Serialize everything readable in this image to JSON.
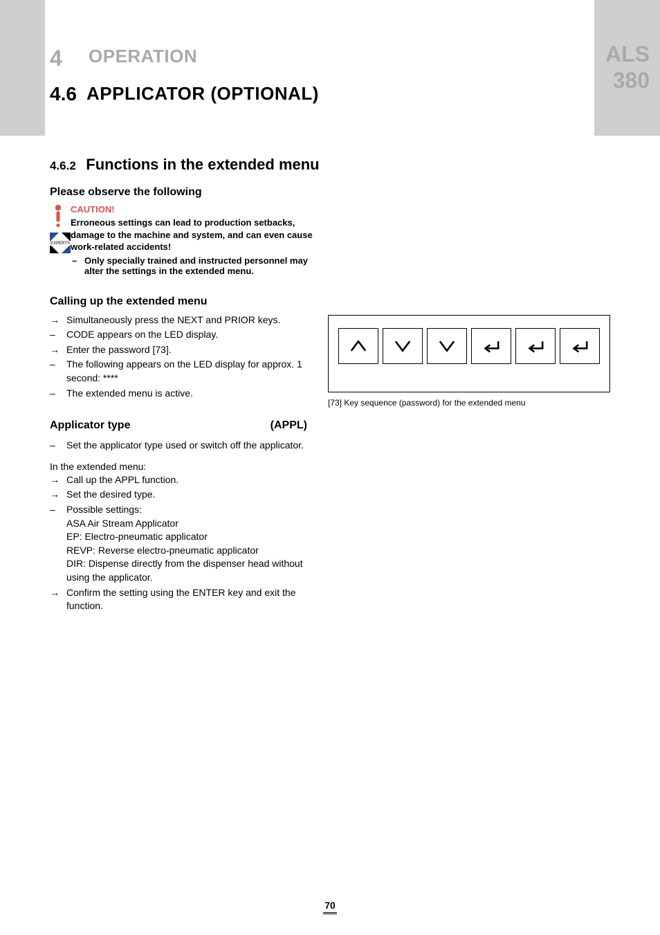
{
  "doc_model_line1": "ALS",
  "doc_model_line2": "380",
  "chapter": {
    "number": "4",
    "title": "OPERATION"
  },
  "section": {
    "number": "4.6",
    "title": "APPLICATOR (OPTIONAL)"
  },
  "subsection": {
    "number": "4.6.2",
    "title": "Functions in the extended menu"
  },
  "please_observe": "Please observe the following",
  "caution": {
    "label": "CAUTION!",
    "body": "Erroneous settings can lead to production setbacks, damage to the machine and system, and can even cause work-related accidents!",
    "bullet": "Only specially trained and instructed personnel may alter the settings in the extended menu."
  },
  "calling_up": {
    "heading": "Calling up the extended menu",
    "items": [
      {
        "marker": "→",
        "text": "Simultaneously press the NEXT and PRIOR keys."
      },
      {
        "marker": "–",
        "text": "CODE appears on the LED display."
      },
      {
        "marker": "→",
        "text": "Enter the password [73]."
      },
      {
        "marker": "–",
        "text": "The following appears on the LED display for approx. 1 second:  ****"
      },
      {
        "marker": "–",
        "text": "The extended menu is active."
      }
    ]
  },
  "figure": {
    "ref": "[73]",
    "caption": "Key sequence (password) for the extended menu"
  },
  "applicator": {
    "title": "Applicator type",
    "code": "(APPL)",
    "intro": {
      "marker": "–",
      "text": "Set the applicator type used or switch off the applicator."
    },
    "menu_line": "In the extended menu:",
    "items": [
      {
        "marker": "→",
        "text": "Call up the APPL function."
      },
      {
        "marker": "→",
        "text": "Set the desired type."
      },
      {
        "marker": "–",
        "text": "Possible settings:\nASA Air Stream Applicator\nEP: Electro-pneumatic applicator\nREVP: Reverse electro-pneumatic applicator\nDIR: Dispense directly from the dispenser head without using the applicator."
      },
      {
        "marker": "→",
        "text": "Confirm the setting using the ENTER key and exit the function."
      }
    ]
  },
  "page_number": "70"
}
